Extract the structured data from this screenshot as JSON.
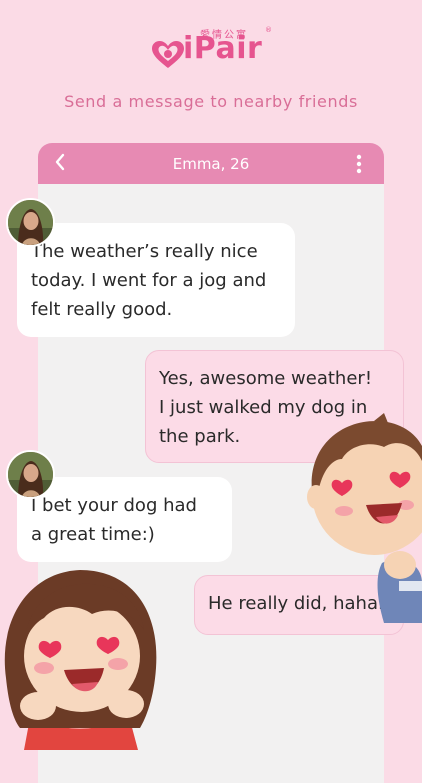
{
  "app": {
    "brand": "iPair",
    "brand_cn": "愛情公寓",
    "registered_mark": "®",
    "tagline": "Send a message to nearby friends"
  },
  "chat": {
    "contact_title": "Emma, 26",
    "messages": [
      {
        "from": "them",
        "text": "The weather’s really nice\ntoday. I went for a jog and\nfelt really good."
      },
      {
        "from": "me",
        "text": "Yes, awesome weather!\nI just walked my dog in\nthe park."
      },
      {
        "from": "them",
        "text": "I bet your dog had\na great time:)"
      },
      {
        "from": "me",
        "text": "He really did, haha."
      }
    ]
  },
  "icons": {
    "logo": "heart-logo-icon",
    "back": "chevron-left-icon",
    "menu": "more-vertical-icon"
  },
  "colors": {
    "background": "#fbdbe6",
    "brand_pink": "#e6548f",
    "header_pink": "#e78ab3",
    "chat_bg": "#f2f1f1",
    "incoming_bubble": "#ffffff",
    "outgoing_bubble": "#fcdbe7"
  }
}
